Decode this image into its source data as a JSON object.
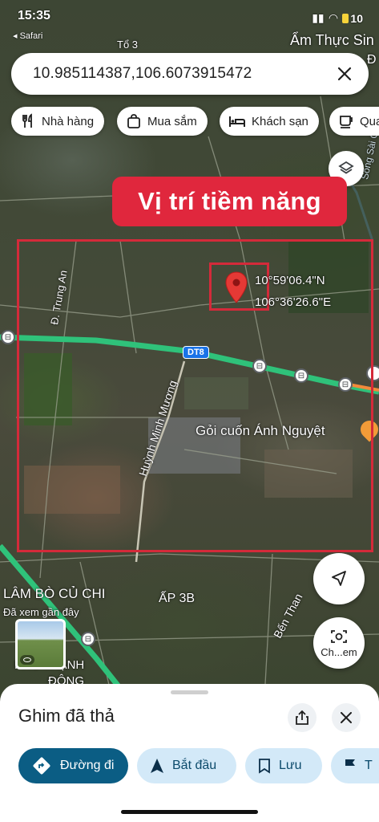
{
  "status_bar": {
    "time": "15:35",
    "back_app": "◂ Safari",
    "battery": "10"
  },
  "search": {
    "value": "10.985114387,106.6073915472"
  },
  "chips": [
    {
      "label": "Nhà hàng",
      "icon": "restaurant-icon"
    },
    {
      "label": "Mua sắm",
      "icon": "shopping-bag-icon"
    },
    {
      "label": "Khách sạn",
      "icon": "hotel-bed-icon"
    },
    {
      "label": "Qua",
      "icon": "coffee-cup-icon"
    }
  ],
  "annotation": {
    "banner": "Vị trí tiềm năng",
    "lat": "10°59'06.4\"N",
    "lng": "106°36'26.6\"E",
    "colors": {
      "banner": "#e0273d",
      "outline": "#d42a3a",
      "pin": "#e53935"
    }
  },
  "map_labels": {
    "top_right": "Ẩm Thực Sin",
    "top_right_2": "Đ",
    "top_left": "Tổ 3",
    "river": "Sông Sài G...",
    "road_trung_an": "Đ. Trung An",
    "road_dt8": "DT8",
    "road_huynh_minh_muong": "Huỳnh Minh Mương",
    "poi_goi_cuon": "Gỏi cuốn Ánh Nguyệt",
    "poi_lam_bo": "LÂM BÒ CỦ CHI",
    "poi_lam_bo_sub": "Đã xem gần đây",
    "ap_3b": "ẤP 3B",
    "ben_than": "Bến Than",
    "phu_thanh_dong_1": "PHÚ THẠNH",
    "phu_thanh_dong_2": "ĐÔNG"
  },
  "controls": {
    "layers_icon": "layers-icon",
    "locate_icon": "navigation-arrow-icon",
    "lens_label": "Ch...em"
  },
  "sheet": {
    "title": "Ghim đã thả",
    "actions": [
      {
        "label": "Đường đi",
        "icon": "directions-icon"
      },
      {
        "label": "Bắt đầu",
        "icon": "navigation-start-icon"
      },
      {
        "label": "Lưu",
        "icon": "bookmark-icon"
      },
      {
        "label": "T",
        "icon": "flag-icon"
      }
    ]
  }
}
